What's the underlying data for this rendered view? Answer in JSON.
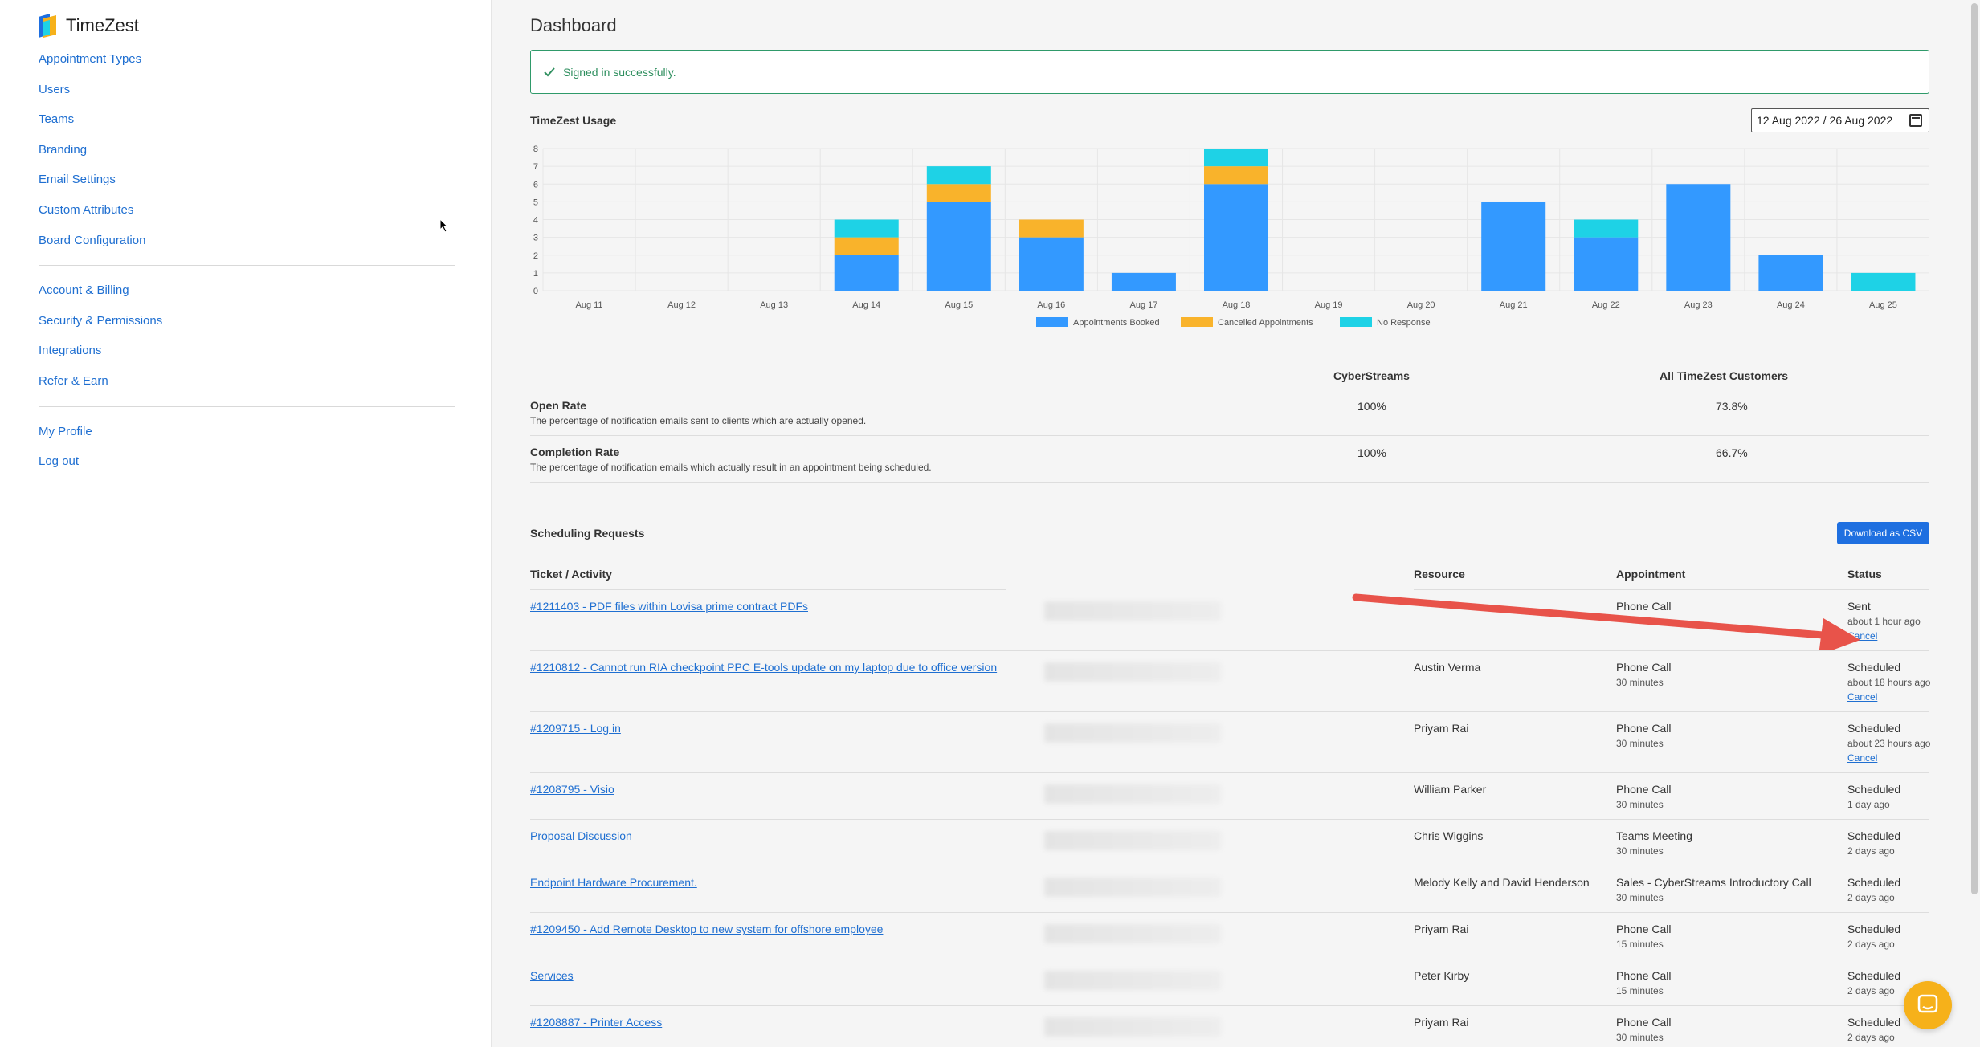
{
  "app": {
    "name": "TimeZest"
  },
  "sidebar": {
    "group1": [
      "Appointment Types",
      "Users",
      "Teams",
      "Branding",
      "Email Settings",
      "Custom Attributes",
      "Board Configuration"
    ],
    "group2": [
      "Account & Billing",
      "Security & Permissions",
      "Integrations",
      "Refer & Earn"
    ],
    "group3": [
      "My Profile",
      "Log out"
    ]
  },
  "main": {
    "title": "Dashboard",
    "alert": "Signed in successfully.",
    "usage_label": "TimeZest Usage",
    "date_from": "12 Aug 2022",
    "date_sep": "/",
    "date_to": "26 Aug 2022"
  },
  "chart_data": {
    "type": "bar",
    "stacked": true,
    "categories": [
      "Aug 11",
      "Aug 12",
      "Aug 13",
      "Aug 14",
      "Aug 15",
      "Aug 16",
      "Aug 17",
      "Aug 18",
      "Aug 19",
      "Aug 20",
      "Aug 21",
      "Aug 22",
      "Aug 23",
      "Aug 24",
      "Aug 25"
    ],
    "series": [
      {
        "name": "Appointments Booked",
        "color": "#3399ff",
        "values": [
          0,
          0,
          0,
          2,
          5,
          3,
          1,
          6,
          0,
          0,
          5,
          3,
          6,
          2,
          0
        ]
      },
      {
        "name": "Cancelled Appointments",
        "color": "#f9b32b",
        "values": [
          0,
          0,
          0,
          1,
          1,
          1,
          0,
          1,
          0,
          0,
          0,
          0,
          0,
          0,
          0
        ]
      },
      {
        "name": "No Response",
        "color": "#1ed2e6",
        "values": [
          0,
          0,
          0,
          1,
          1,
          0,
          0,
          1,
          0,
          0,
          0,
          1,
          0,
          0,
          1
        ]
      }
    ],
    "yticks": [
      0,
      1,
      2,
      3,
      4,
      5,
      6,
      7,
      8
    ],
    "ylim": [
      0,
      8
    ],
    "grid": true,
    "legend": "bottom"
  },
  "rates": {
    "col1": "CyberStreams",
    "col2": "All TimeZest Customers",
    "rows": [
      {
        "name": "Open Rate",
        "desc": "The percentage of notification emails sent to clients which are actually opened.",
        "v1": "100%",
        "v2": "73.8%"
      },
      {
        "name": "Completion Rate",
        "desc": "The percentage of notification emails which actually result in an appointment being scheduled.",
        "v1": "100%",
        "v2": "66.7%"
      }
    ]
  },
  "scheduling": {
    "label": "Scheduling Requests",
    "csv_label": "Download as CSV",
    "headers": {
      "ticket": "Ticket / Activity",
      "resource": "Resource",
      "appointment": "Appointment",
      "status": "Status"
    },
    "rows": [
      {
        "ticket": "#1211403 - PDF files within Lovisa prime contract PDFs",
        "resource": "",
        "appointment": "Phone Call",
        "duration": "",
        "status": "Sent",
        "since": "about 1 hour ago",
        "cancel": "Cancel"
      },
      {
        "ticket": "#1210812 - Cannot run RIA checkpoint PPC E-tools update on my laptop due to office version",
        "resource": "Austin Verma",
        "appointment": "Phone Call",
        "duration": "30 minutes",
        "status": "Scheduled",
        "since": "about 18 hours ago",
        "cancel": "Cancel"
      },
      {
        "ticket": "#1209715 - Log in",
        "resource": "Priyam Rai",
        "appointment": "Phone Call",
        "duration": "30 minutes",
        "status": "Scheduled",
        "since": "about 23 hours ago",
        "cancel": "Cancel"
      },
      {
        "ticket": "#1208795 - Visio",
        "resource": "William Parker",
        "appointment": "Phone Call",
        "duration": "30 minutes",
        "status": "Scheduled",
        "since": "1 day ago",
        "cancel": ""
      },
      {
        "ticket": "Proposal Discussion",
        "resource": "Chris Wiggins",
        "appointment": "Teams Meeting",
        "duration": "30 minutes",
        "status": "Scheduled",
        "since": "2 days ago",
        "cancel": ""
      },
      {
        "ticket": "Endpoint Hardware Procurement.",
        "resource": "Melody Kelly and David Henderson",
        "appointment": "Sales - CyberStreams Introductory Call",
        "duration": "30 minutes",
        "status": "Scheduled",
        "since": "2 days ago",
        "cancel": ""
      },
      {
        "ticket": "#1209450 - Add Remote Desktop to new system for offshore employee",
        "resource": "Priyam Rai",
        "appointment": "Phone Call",
        "duration": "15 minutes",
        "status": "Scheduled",
        "since": "2 days ago",
        "cancel": ""
      },
      {
        "ticket": "Services",
        "resource": "Peter Kirby",
        "appointment": "Phone Call",
        "duration": "15 minutes",
        "status": "Scheduled",
        "since": "2 days ago",
        "cancel": ""
      },
      {
        "ticket": "#1208887 - Printer Access",
        "resource": "Priyam Rai",
        "appointment": "Phone Call",
        "duration": "30 minutes",
        "status": "Scheduled",
        "since": "2 days ago",
        "cancel": ""
      }
    ]
  }
}
